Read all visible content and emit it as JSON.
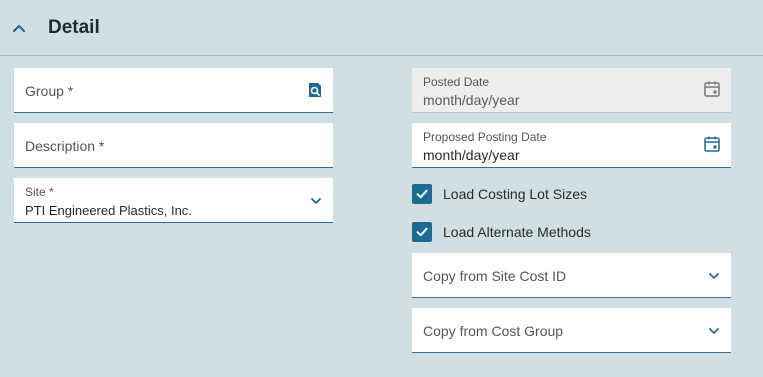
{
  "section": {
    "title": "Detail",
    "toggle_icon": "chevron-up-icon"
  },
  "left": {
    "group": {
      "placeholder": "Group *",
      "icon": "search-icon"
    },
    "description": {
      "placeholder": "Description *"
    },
    "site": {
      "label": "Site *",
      "value": "PTI Engineered Plastics, Inc.",
      "icon": "chevron-down-icon"
    }
  },
  "right": {
    "posted_date": {
      "label": "Posted Date",
      "value": "month/day/year",
      "icon": "calendar-icon",
      "disabled": true
    },
    "proposed_posting_date": {
      "label": "Proposed Posting Date",
      "value": "month/day/year",
      "icon": "calendar-icon"
    },
    "load_costing_lot_sizes": {
      "label": "Load Costing Lot Sizes",
      "checked": true
    },
    "load_alternate_methods": {
      "label": "Load Alternate Methods",
      "checked": true
    },
    "copy_from_site_cost_id": {
      "placeholder": "Copy from Site Cost ID",
      "icon": "chevron-down-icon"
    },
    "copy_from_cost_group": {
      "placeholder": "Copy from Cost Group",
      "icon": "chevron-down-icon"
    }
  },
  "colors": {
    "background": "#d1dfe3",
    "accent": "#1c6b94",
    "field_bg": "#ffffff",
    "disabled_bg": "#eeeeee"
  }
}
